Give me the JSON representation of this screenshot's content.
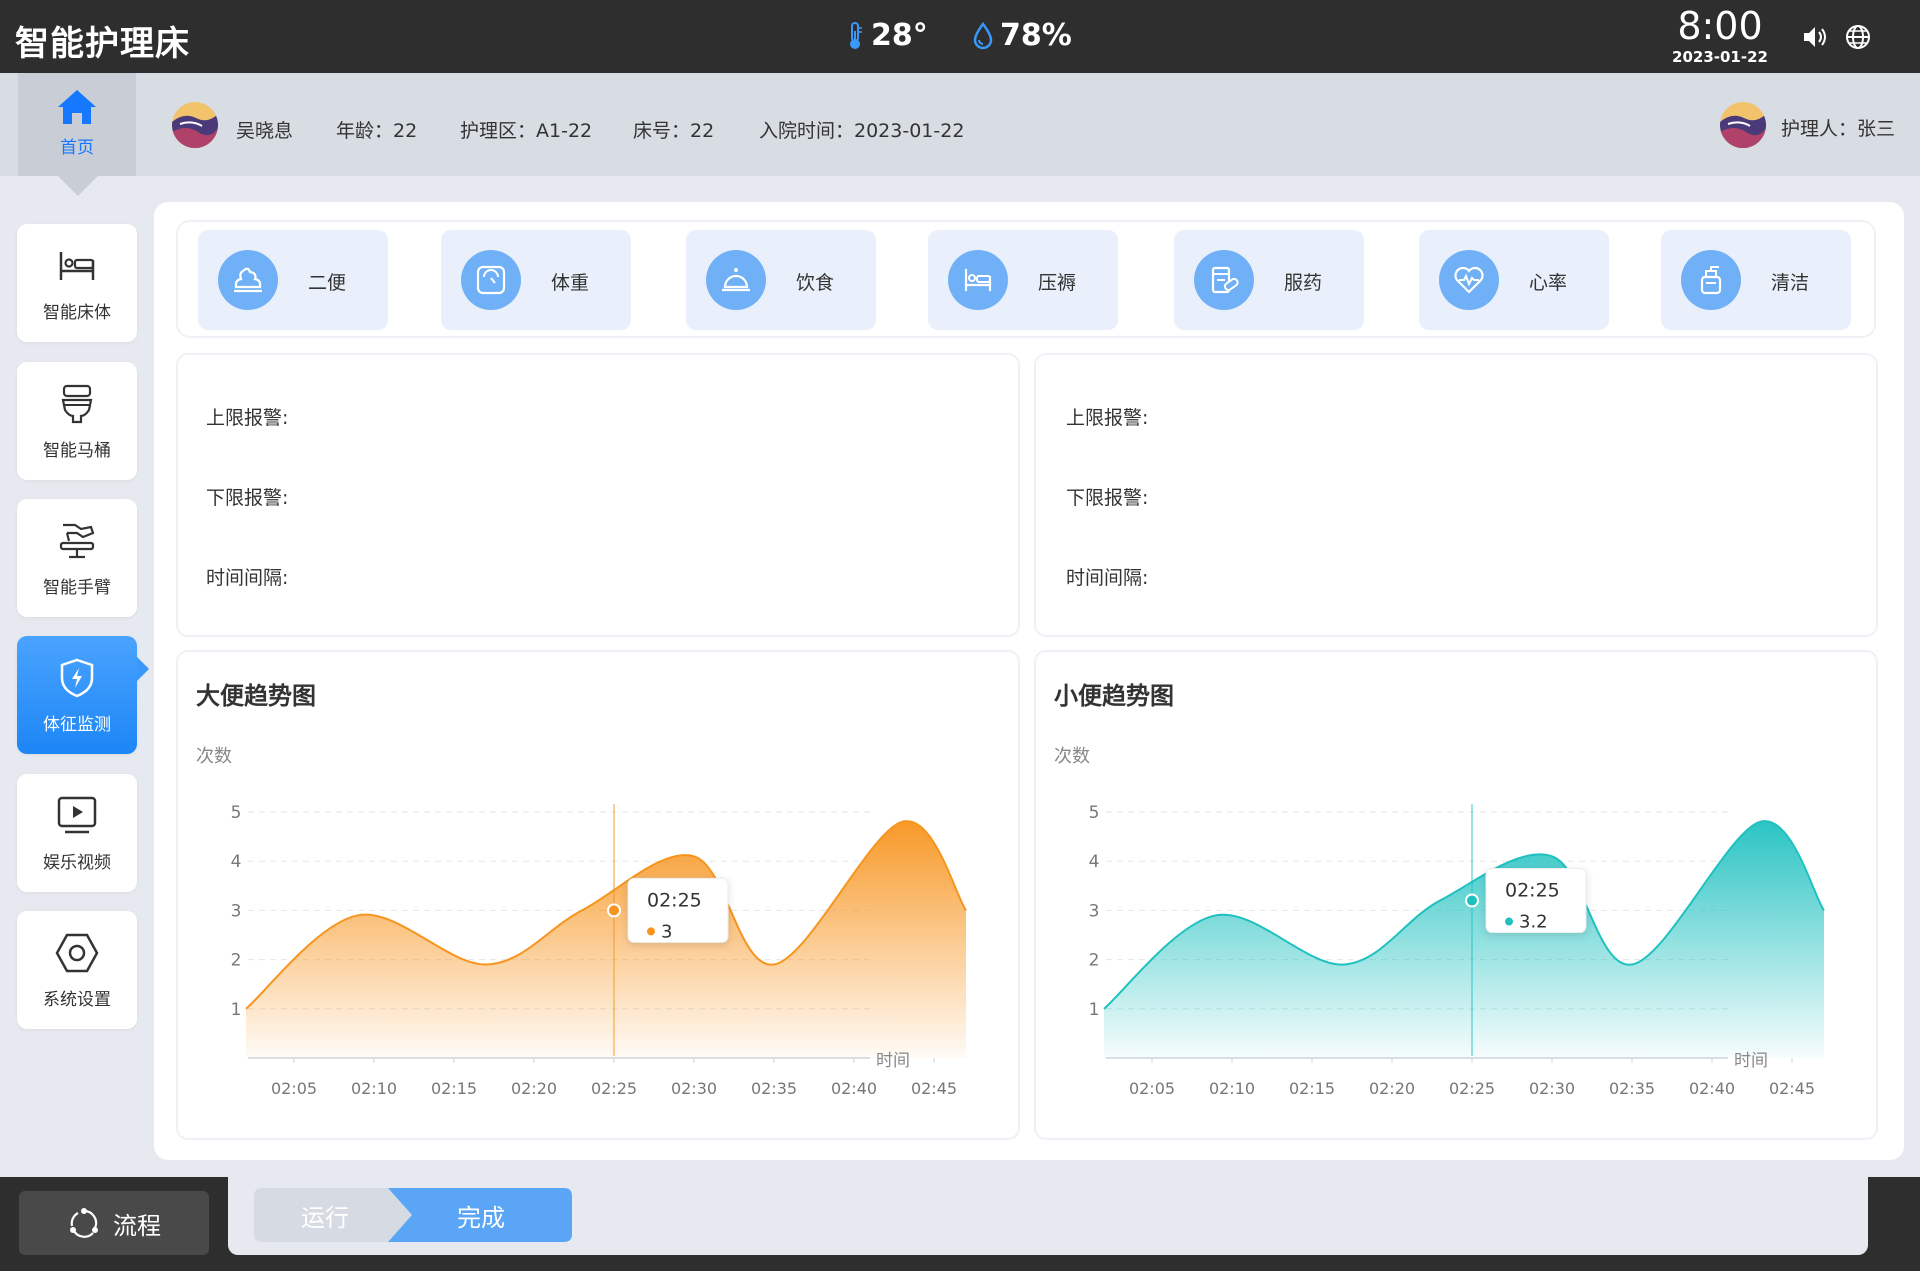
{
  "header": {
    "app_title": "智能护理床",
    "temperature": "28°",
    "humidity": "78%",
    "time": "8:00",
    "date": "2023-01-22",
    "icons": [
      "thermometer-icon",
      "water-drop-icon",
      "volume-icon",
      "globe-icon"
    ]
  },
  "home_tab": {
    "label": "首页",
    "icon": "home-icon"
  },
  "patient": {
    "name": "吴晓息",
    "age": "年龄：22",
    "care_area": "护理区：A1-22",
    "bed_no": "床号：22",
    "admission": "入院时间：2023-01-22"
  },
  "caregiver": "护理人：张三",
  "sidebar": {
    "items": [
      {
        "label": "智能床体",
        "icon": "bed-icon",
        "active": false
      },
      {
        "label": "智能马桶",
        "icon": "toilet-icon",
        "active": false
      },
      {
        "label": "智能手臂",
        "icon": "robot-arm-icon",
        "active": false
      },
      {
        "label": "体征监测",
        "icon": "shield-bolt-icon",
        "active": true
      },
      {
        "label": "娱乐视频",
        "icon": "video-icon",
        "active": false
      },
      {
        "label": "系统设置",
        "icon": "hex-settings-icon",
        "active": false
      }
    ]
  },
  "care_items": [
    {
      "label": "二便",
      "icon": "stool-icon"
    },
    {
      "label": "体重",
      "icon": "scale-icon"
    },
    {
      "label": "饮食",
      "icon": "food-cloche-icon"
    },
    {
      "label": "压褥",
      "icon": "bed-sore-icon"
    },
    {
      "label": "服药",
      "icon": "medicine-icon"
    },
    {
      "label": "心率",
      "icon": "heart-rate-icon"
    },
    {
      "label": "清洁",
      "icon": "cleaning-bottle-icon"
    }
  ],
  "alarms": {
    "left": {
      "upper": "上限报警:",
      "lower": "下限报警:",
      "interval": "时间间隔:"
    },
    "right": {
      "upper": "上限报警:",
      "lower": "下限报警:",
      "interval": "时间间隔:"
    }
  },
  "colors": {
    "accent": "#1d86f5",
    "stool": "#f7941d",
    "urine": "#1fc1c0"
  },
  "chart_data": [
    {
      "type": "area",
      "title": "大便趋势图",
      "ylabel": "次数",
      "xlabel": "时间",
      "categories": [
        "02:05",
        "02:10",
        "02:15",
        "02:20",
        "02:25",
        "02:30",
        "02:35",
        "02:40",
        "02:45"
      ],
      "y_ticks": [
        1,
        2,
        3,
        4,
        5
      ],
      "ylim": [
        0,
        5
      ],
      "x": [
        "02:02",
        "02:09",
        "02:17",
        "02:23",
        "02:30",
        "02:35",
        "02:43",
        "02:47"
      ],
      "values": [
        1.0,
        2.9,
        1.9,
        3.0,
        4.1,
        1.9,
        4.8,
        3.0
      ],
      "tooltip": {
        "x": "02:25",
        "value": "3"
      },
      "color": "#f7941d"
    },
    {
      "type": "area",
      "title": "小便趋势图",
      "ylabel": "次数",
      "xlabel": "时间",
      "categories": [
        "02:05",
        "02:10",
        "02:15",
        "02:20",
        "02:25",
        "02:30",
        "02:35",
        "02:40",
        "02:45"
      ],
      "y_ticks": [
        1,
        2,
        3,
        4,
        5
      ],
      "ylim": [
        0,
        5
      ],
      "x": [
        "02:02",
        "02:09",
        "02:17",
        "02:23",
        "02:30",
        "02:35",
        "02:43",
        "02:47"
      ],
      "values": [
        1.0,
        2.9,
        1.9,
        3.2,
        4.1,
        1.9,
        4.8,
        3.0
      ],
      "tooltip": {
        "x": "02:25",
        "value": "3.2"
      },
      "color": "#1fc1c0"
    }
  ],
  "footer": {
    "flow_label": "流程",
    "steps": [
      {
        "label": "运行",
        "state": "done"
      },
      {
        "label": "完成",
        "state": "current"
      }
    ]
  }
}
